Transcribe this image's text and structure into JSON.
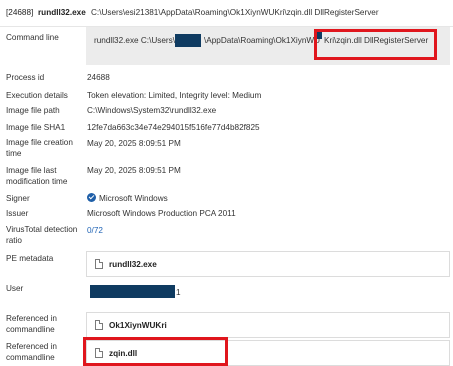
{
  "header": {
    "pid": "[24688]",
    "process_name": "rundll32.exe",
    "command": "C:\\Users\\esi21381\\AppData\\Roaming\\Ok1XiynWUKri\\zqin.dll DllRegisterServer"
  },
  "details": {
    "command_line_label": "Command line",
    "command_line_parts": {
      "a": "rundll32.exe C:\\Users\\e",
      "b": "\\AppData\\Roaming\\Ok1XiynWU",
      "c": "Kri\\zqin.dll DllRegisterServer"
    },
    "process_id_label": "Process id",
    "process_id": "24688",
    "execution_details_label": "Execution details",
    "execution_details": "Token elevation: Limited, Integrity level: Medium",
    "image_path_label": "Image file path",
    "image_path": "C:\\Windows\\System32\\rundll32.exe",
    "sha1_label": "Image file SHA1",
    "sha1": "12fe7da663c34e74e294015f516fe77d4b82f825",
    "creation_label": "Image file creation time",
    "creation_time": "May 20, 2025 8:09:51 PM",
    "modification_label": "Image file last modification time",
    "modification_time": "May 20, 2025 8:09:51 PM",
    "signer_label": "Signer",
    "signer": "Microsoft Windows",
    "issuer_label": "Issuer",
    "issuer": "Microsoft Windows Production PCA 2011",
    "virustotal_label": "VirusTotal detection ratio",
    "virustotal": "0/72",
    "pe_label": "PE metadata",
    "pe_value": "rundll32.exe",
    "user_label": "User",
    "user_suffix": "1",
    "ref1_label": "Referenced in commandline",
    "ref1_value": "Ok1XiynWUKri",
    "ref2_label": "Referenced in commandline",
    "ref2_value": "zqin.dll"
  },
  "colors": {
    "highlight": "#e0161d",
    "redaction": "#0f3b61",
    "link": "#1f63b5"
  }
}
